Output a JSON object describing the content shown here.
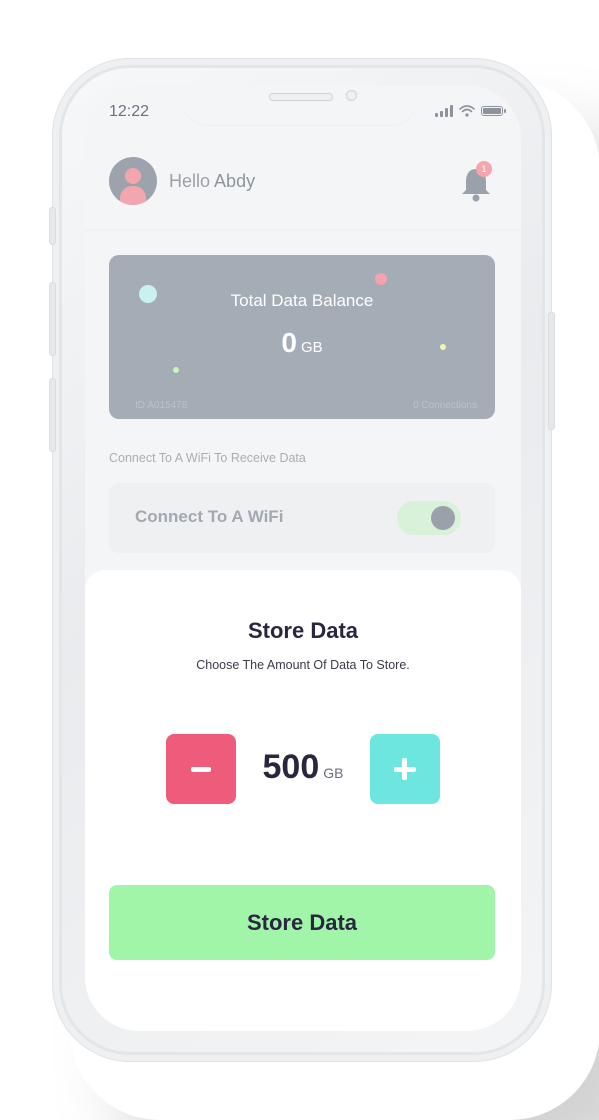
{
  "status_bar": {
    "time": "12:22"
  },
  "header": {
    "greeting": "Hello",
    "user_name": "Abdy",
    "notification_count": "1"
  },
  "balance_card": {
    "title": "Total Data Balance",
    "value": "0",
    "unit": "GB",
    "id_label": "ID A015478",
    "connections_label": "0 Connections",
    "colors": {
      "card": "#a4acb5",
      "dot_cyan": "#c9f2ef",
      "dot_pink": "#f4a3ad",
      "dot_green": "#c6f7b5",
      "dot_yellow": "#f3f5b0"
    }
  },
  "wifi": {
    "section_label": "Connect To A WiFi To Receive Data",
    "row_label": "Connect To A WiFi",
    "toggle_on": true
  },
  "store_sheet": {
    "title": "Store Data",
    "subtitle": "Choose The Amount Of Data To Store.",
    "amount": "500",
    "unit": "GB",
    "button_label": "Store Data",
    "colors": {
      "minus": "#ef5b7b",
      "plus": "#6de6e0",
      "button": "#a1f5a8"
    }
  },
  "icons": {
    "minus": "minus-icon",
    "plus": "plus-icon",
    "bell": "bell-icon",
    "avatar": "avatar-icon"
  }
}
